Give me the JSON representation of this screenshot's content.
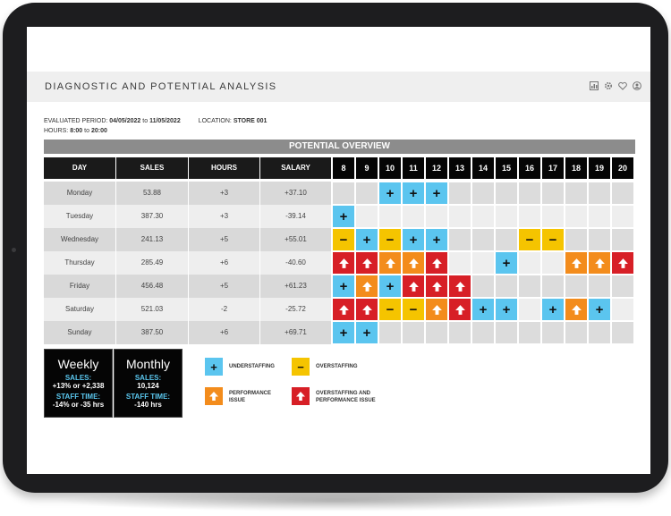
{
  "header": {
    "title": "DIAGNOSTIC AND POTENTIAL ANALYSIS",
    "icons": [
      "chart-icon",
      "gear-icon",
      "heart-icon",
      "user-icon"
    ]
  },
  "meta": {
    "period_label": "EVALUATED PERIOD:",
    "period_from": "04/05/2022",
    "period_to_word": "to",
    "period_to": "11/05/2022",
    "location_label": "LOCATION:",
    "location_value": "STORE 001",
    "hours_label": "HOURS:",
    "hours_from": "8:00",
    "hours_to_word": "to",
    "hours_to": "20:00"
  },
  "overview_title": "POTENTIAL OVERVIEW",
  "columns": [
    "DAY",
    "SALES",
    "HOURS",
    "SALARY"
  ],
  "hour_columns": [
    "8",
    "9",
    "10",
    "11",
    "12",
    "13",
    "14",
    "15",
    "16",
    "17",
    "18",
    "19",
    "20"
  ],
  "colors": {
    "under": "#5bc5ef",
    "over": "#f5c400",
    "perf": "#f38c1c",
    "both": "#d71f26",
    "empty_a": "#dcdcdc",
    "empty_b": "#eeeeee"
  },
  "rows": [
    {
      "day": "Monday",
      "sales": "53.88",
      "hours": "+3",
      "salary": "+37.10",
      "cells": [
        "",
        "",
        "U",
        "U",
        "U",
        "",
        "",
        "",
        "",
        "",
        "",
        "",
        ""
      ]
    },
    {
      "day": "Tuesday",
      "sales": "387.30",
      "hours": "+3",
      "salary": "-39.14",
      "cells": [
        "U",
        "",
        "",
        "",
        "",
        "",
        "",
        "",
        "",
        "",
        "",
        "",
        ""
      ]
    },
    {
      "day": "Wednesday",
      "sales": "241.13",
      "hours": "+5",
      "salary": "+55.01",
      "cells": [
        "O",
        "U",
        "O",
        "U",
        "U",
        "",
        "",
        "",
        "O",
        "O",
        "",
        "",
        ""
      ]
    },
    {
      "day": "Thursday",
      "sales": "285.49",
      "hours": "+6",
      "salary": "-40.60",
      "cells": [
        "B",
        "B",
        "P",
        "P",
        "B",
        "",
        "",
        "U",
        "",
        "",
        "P",
        "P",
        "B"
      ]
    },
    {
      "day": "Friday",
      "sales": "456.48",
      "hours": "+5",
      "salary": "+61.23",
      "cells": [
        "U",
        "P",
        "U",
        "B",
        "B",
        "B",
        "",
        "",
        "",
        "",
        "",
        "",
        ""
      ]
    },
    {
      "day": "Saturday",
      "sales": "521.03",
      "hours": "-2",
      "salary": "-25.72",
      "cells": [
        "B",
        "B",
        "O",
        "O",
        "P",
        "B",
        "U",
        "U",
        "",
        "U",
        "P",
        "U",
        ""
      ]
    },
    {
      "day": "Sunday",
      "sales": "387.50",
      "hours": "+6",
      "salary": "+69.71",
      "cells": [
        "U",
        "U",
        "",
        "",
        "",
        "",
        "",
        "",
        "",
        "",
        "",
        "",
        ""
      ]
    }
  ],
  "summary": {
    "weekly": {
      "title": "Weekly",
      "sales_label": "SALES:",
      "sales_value": "+13% or +2,338",
      "staff_label": "STAFF TIME:",
      "staff_value": "-14% or -35 hrs"
    },
    "monthly": {
      "title": "Monthly",
      "sales_label": "SALES:",
      "sales_value": "10,124",
      "staff_label": "STAFF TIME:",
      "staff_value": "-140 hrs"
    }
  },
  "legend": {
    "under": "UNDERSTAFFING",
    "over": "OVERSTAFFING",
    "perf_line1": "PERFORMANCE",
    "perf_line2": "ISSUE",
    "both_line1": "OVERSTAFFING AND",
    "both_line2": "PERFORMANCE ISSUE"
  }
}
